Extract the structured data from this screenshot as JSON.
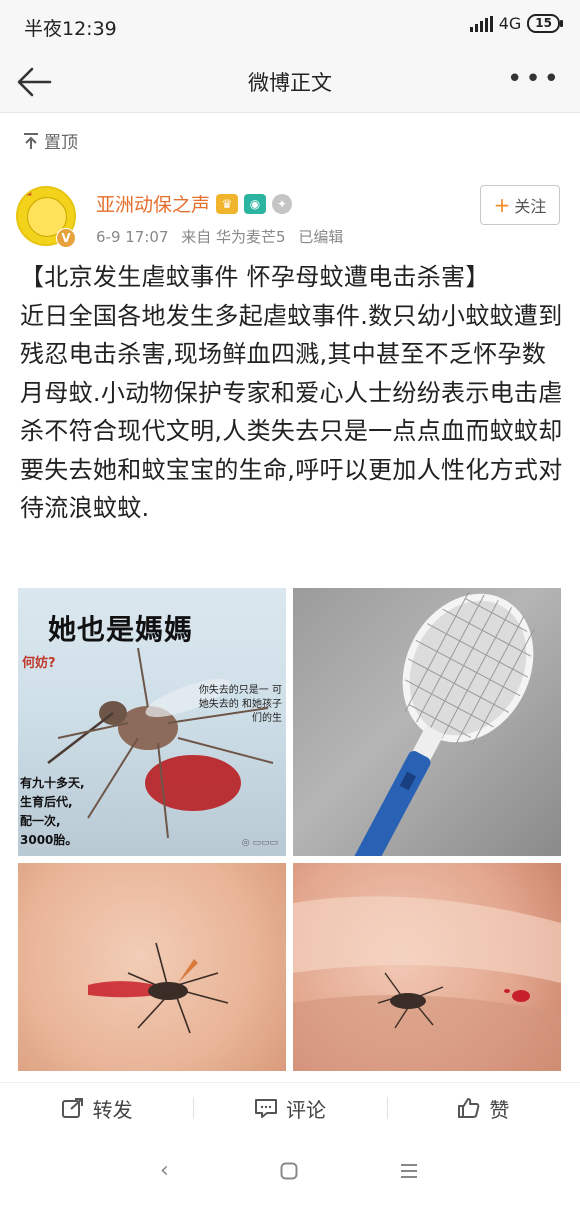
{
  "status_bar": {
    "time": "半夜12:39",
    "network": "4G",
    "battery": "15"
  },
  "nav": {
    "title": "微博正文",
    "back_icon": "arrow-left-icon",
    "more_icon": "more-dots-icon"
  },
  "pinned": {
    "label": "置顶"
  },
  "author": {
    "name": "亚洲动保之声",
    "date": "6-9 17:07",
    "source": "来自 华为麦芒5",
    "edited": "已编辑",
    "follow_label": "关注",
    "verified_badge": "V"
  },
  "post": {
    "title": "【北京发生虐蚊事件 怀孕母蚊遭电击杀害】",
    "body": "近日全国各地发生多起虐蚊事件.数只幼小蚊蚊遭到残忍电击杀害,现场鲜血四溅,其中甚至不乏怀孕数月母蚊.小动物保护专家和爱心人士纷纷表示电击虐杀不符合现代文明,人类失去只是一点点血而蚊蚊却要失去她和蚊宝宝的生命,呼吁以更加人性化方式对待流浪蚊蚊."
  },
  "images": {
    "img1": {
      "caption": "她也是媽媽",
      "question": "何妨?",
      "side_text": "你失去的只是一 可她失去的 和她孩子们的生",
      "left_text_1": "有九十多天,",
      "left_text_2": "生育后代,",
      "left_text_3": "配一次,",
      "left_text_4": "3000胎。"
    }
  },
  "actions": {
    "repost": "转发",
    "comment": "评论",
    "like": "赞"
  },
  "colors": {
    "accent_orange": "#e76f2d",
    "text": "#222222",
    "muted": "#888888"
  }
}
